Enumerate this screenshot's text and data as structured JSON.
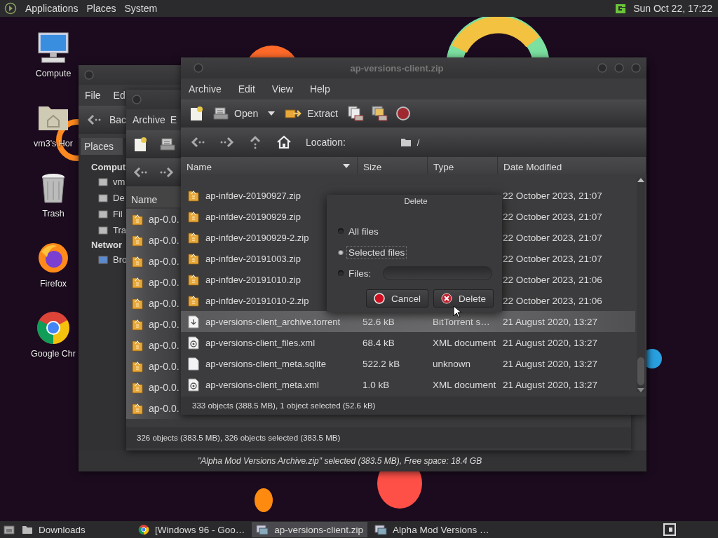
{
  "top_panel": {
    "menus": [
      "Applications",
      "Places",
      "System"
    ],
    "clock": "Sun Oct 22, 17:22"
  },
  "desktop_icons": [
    {
      "label": "Compute",
      "kind": "computer"
    },
    {
      "label": "vm3's Hor",
      "kind": "home"
    },
    {
      "label": "Trash",
      "kind": "trash"
    },
    {
      "label": "Firefox",
      "kind": "firefox"
    },
    {
      "label": "Google Chr",
      "kind": "chrome"
    }
  ],
  "file_manager": {
    "menus": [
      "File",
      "Ed"
    ],
    "back_button": "Bac",
    "places_selector": "Places",
    "sidebar": [
      {
        "label": "Comput",
        "kind": "heading"
      },
      {
        "label": "vm",
        "kind": "home"
      },
      {
        "label": "De",
        "kind": "desktop"
      },
      {
        "label": "Fil",
        "kind": "drive"
      },
      {
        "label": "Tra",
        "kind": "trash"
      },
      {
        "label": "Networ",
        "kind": "heading"
      },
      {
        "label": "Bro",
        "kind": "network"
      }
    ],
    "status_bar": "\"Alpha Mod Versions Archive.zip\" selected (383.5 MB), Free space: 18.4 GB"
  },
  "archive_window": {
    "menus": [
      "Archive",
      "E"
    ],
    "column": "Name",
    "rows": [
      {
        "name": "ap-0.0.",
        "selected": true
      },
      {
        "name": "ap-0.0.",
        "selected": true
      },
      {
        "name": "ap-0.0.",
        "selected": true
      },
      {
        "name": "ap-0.0.",
        "selected": true
      },
      {
        "name": "ap-0.0.",
        "selected": true
      },
      {
        "name": "ap-0.0.",
        "selected": true
      },
      {
        "name": "ap-0.0.",
        "selected": true
      },
      {
        "name": "ap-0.0.",
        "selected": true
      },
      {
        "name": "ap-0.0.",
        "selected": true
      },
      {
        "name": "ap-0.0.",
        "selected": true
      }
    ],
    "status_bar": "326 objects (383.5 MB), 326 objects selected (383.5 MB)"
  },
  "main_window": {
    "title": "ap-versions-client.zip",
    "menus": [
      "Archive",
      "Edit",
      "View",
      "Help"
    ],
    "toolbar": {
      "open": "Open",
      "extract": "Extract"
    },
    "location_label": "Location:",
    "location": "/",
    "columns": [
      "Name",
      "Size",
      "Type",
      "Date Modified"
    ],
    "rows": [
      {
        "name": "ap-infdev-20190927.zip",
        "date": "22 October 2023, 21:07",
        "kind": "zip",
        "selected": false
      },
      {
        "name": "ap-infdev-20190929.zip",
        "date": "22 October 2023, 21:07",
        "kind": "zip",
        "selected": false
      },
      {
        "name": "ap-infdev-20190929-2.zip",
        "date": "22 October 2023, 21:07",
        "kind": "zip",
        "selected": false
      },
      {
        "name": "ap-infdev-20191003.zip",
        "date": "22 October 2023, 21:07",
        "kind": "zip",
        "selected": false
      },
      {
        "name": "ap-infdev-20191010.zip",
        "date": "22 October 2023, 21:06",
        "kind": "zip",
        "selected": false
      },
      {
        "name": "ap-infdev-20191010-2.zip",
        "date": "22 October 2023, 21:06",
        "kind": "zip",
        "selected": false
      },
      {
        "name": "ap-versions-client_archive.torrent",
        "size": "52.6 kB",
        "type": "BitTorrent s…",
        "date": "21 August 2020, 13:27",
        "kind": "torrent",
        "selected": true
      },
      {
        "name": "ap-versions-client_files.xml",
        "size": "68.4 kB",
        "type": "XML document",
        "date": "21 August 2020, 13:27",
        "kind": "xml",
        "selected": false
      },
      {
        "name": "ap-versions-client_meta.sqlite",
        "size": "522.2 kB",
        "type": "unknown",
        "date": "21 August 2020, 13:27",
        "kind": "file",
        "selected": false
      },
      {
        "name": "ap-versions-client_meta.xml",
        "size": "1.0 kB",
        "type": "XML document",
        "date": "21 August 2020, 13:27",
        "kind": "xml",
        "selected": false
      }
    ],
    "status_bar": "333 objects (388.5 MB), 1 object selected (52.6 kB)"
  },
  "delete_dialog": {
    "title": "Delete",
    "options": [
      {
        "label": "All files",
        "selected": false,
        "has_field": false
      },
      {
        "label": "Selected files",
        "selected": true,
        "has_field": false
      },
      {
        "label": "Files:",
        "selected": false,
        "has_field": true
      }
    ],
    "buttons": [
      {
        "label": "Cancel",
        "kind": "cancel"
      },
      {
        "label": "Delete",
        "kind": "delete"
      }
    ]
  },
  "taskbar": {
    "items": [
      {
        "label": "Downloads",
        "kind": "folder",
        "selected": false
      },
      {
        "label": "[Windows 96 - Goo…",
        "kind": "browser",
        "selected": false
      },
      {
        "label": "ap-versions-client.zip",
        "kind": "archive",
        "selected": true
      },
      {
        "label": "Alpha Mod Versions …",
        "kind": "archive",
        "selected": false
      }
    ]
  }
}
